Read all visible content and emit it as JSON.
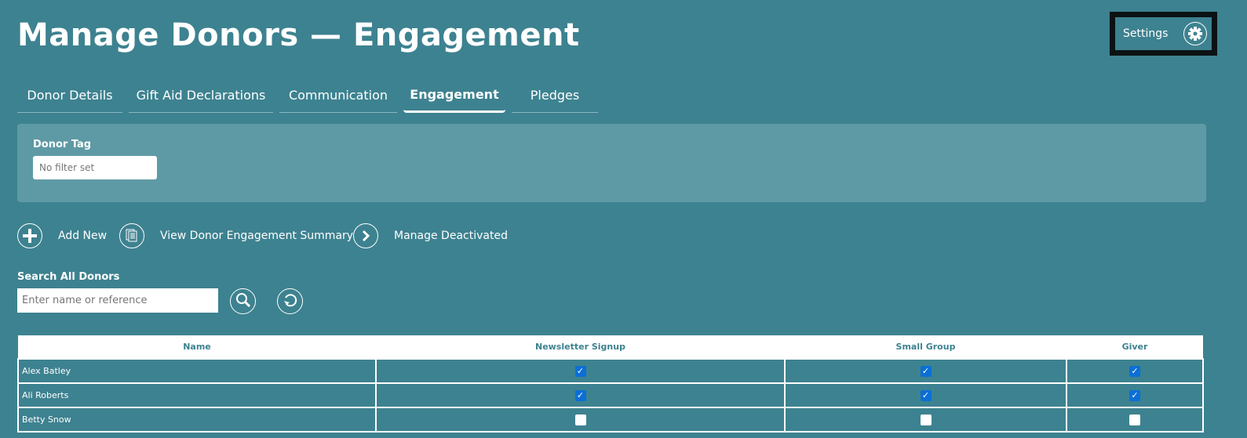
{
  "header": {
    "title": "Manage Donors — Engagement",
    "settings_label": "Settings"
  },
  "tabs": [
    {
      "label": "Donor Details"
    },
    {
      "label": "Gift Aid Declarations"
    },
    {
      "label": "Communication"
    },
    {
      "label": "Engagement",
      "active": true
    },
    {
      "label": "Pledges"
    }
  ],
  "filter": {
    "label": "Donor Tag",
    "value": "No filter set"
  },
  "actions": {
    "add": "Add New",
    "summary": "View Donor Engagement Summary",
    "deactivated": "Manage Deactivated"
  },
  "search": {
    "label": "Search All Donors",
    "placeholder": "Enter name or reference"
  },
  "table": {
    "columns": [
      "Name",
      "Newsletter Signup",
      "Small Group",
      "Giver"
    ],
    "rows": [
      {
        "name": "Alex Batley",
        "newsletter": true,
        "small_group": true,
        "giver": true
      },
      {
        "name": "Ali Roberts",
        "newsletter": true,
        "small_group": true,
        "giver": true
      },
      {
        "name": "Betty Snow",
        "newsletter": false,
        "small_group": false,
        "giver": false
      }
    ]
  },
  "colors": {
    "background": "#3d8290",
    "panel": "#5e9aa5",
    "checkbox": "#0b6fd6"
  }
}
